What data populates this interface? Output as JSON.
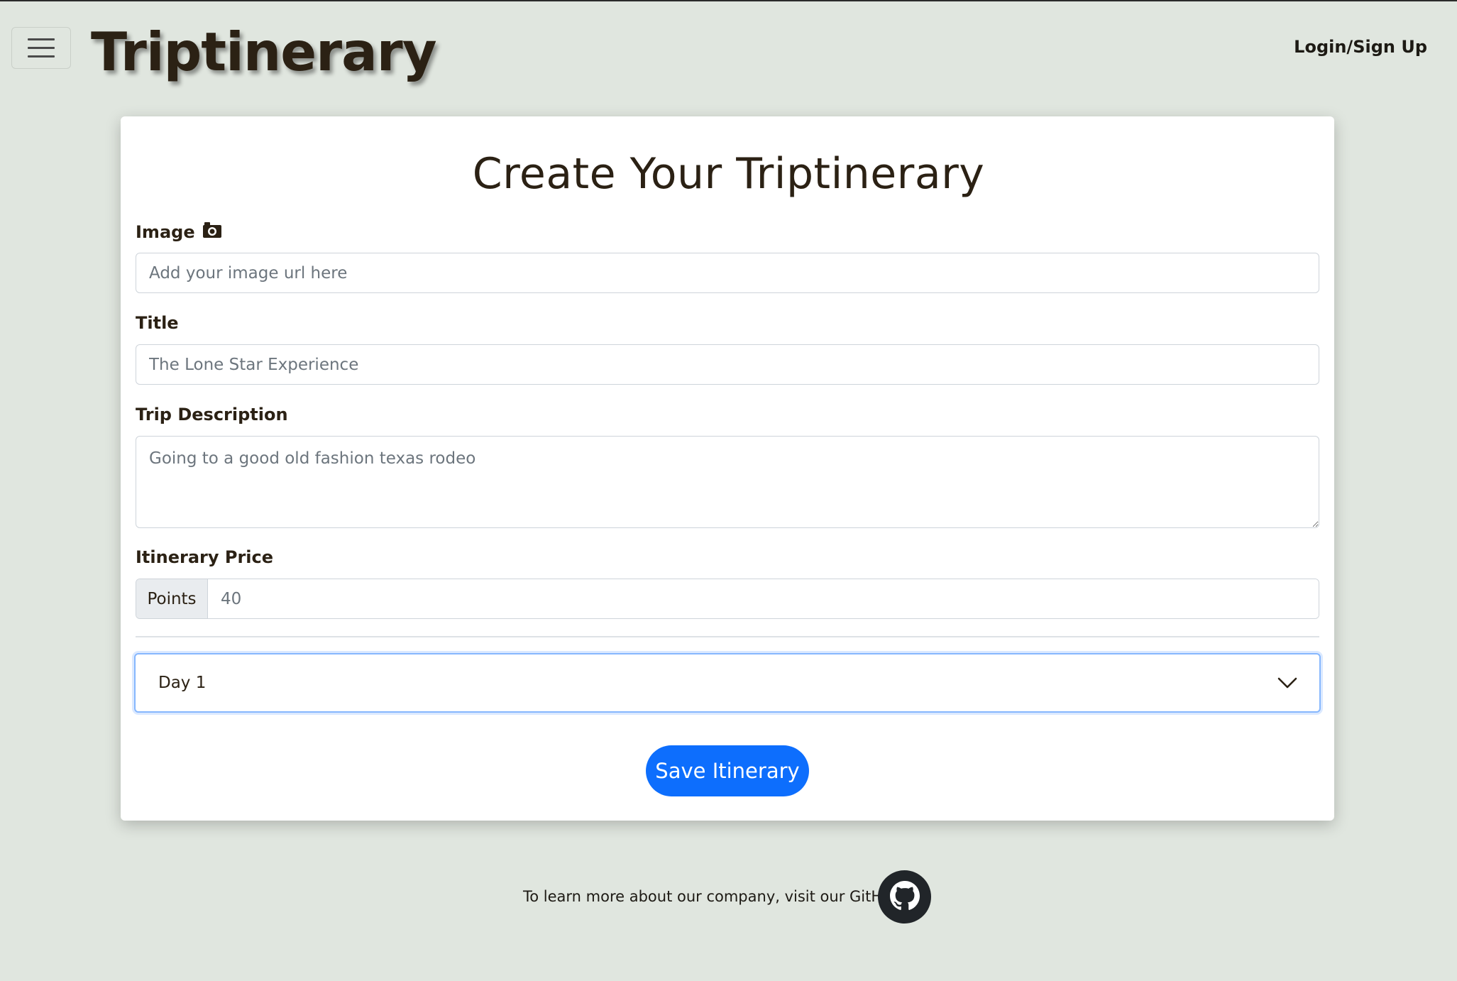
{
  "header": {
    "menu_icon": "hamburger-menu-icon",
    "brand": "Triptinerary",
    "login_label": "Login/Sign Up"
  },
  "form": {
    "heading": "Create Your Triptinerary",
    "image": {
      "label": "Image",
      "icon": "camera-icon",
      "placeholder": "Add your image url here",
      "value": ""
    },
    "title": {
      "label": "Title",
      "placeholder": "The Lone Star Experience",
      "value": ""
    },
    "description": {
      "label": "Trip Description",
      "placeholder": "Going to a good old fashion texas rodeo",
      "value": ""
    },
    "price": {
      "label": "Itinerary Price",
      "prefix": "Points",
      "placeholder": "40",
      "value": ""
    },
    "day_select": {
      "selected": "Day 1",
      "icon": "chevron-down-icon"
    },
    "save_label": "Save Itinerary"
  },
  "footer": {
    "text": "To learn more about our company, visit our GitHub",
    "icon": "github-icon"
  },
  "colors": {
    "background": "#e0e6df",
    "primary": "#0d6efd",
    "text": "#2b2114"
  }
}
